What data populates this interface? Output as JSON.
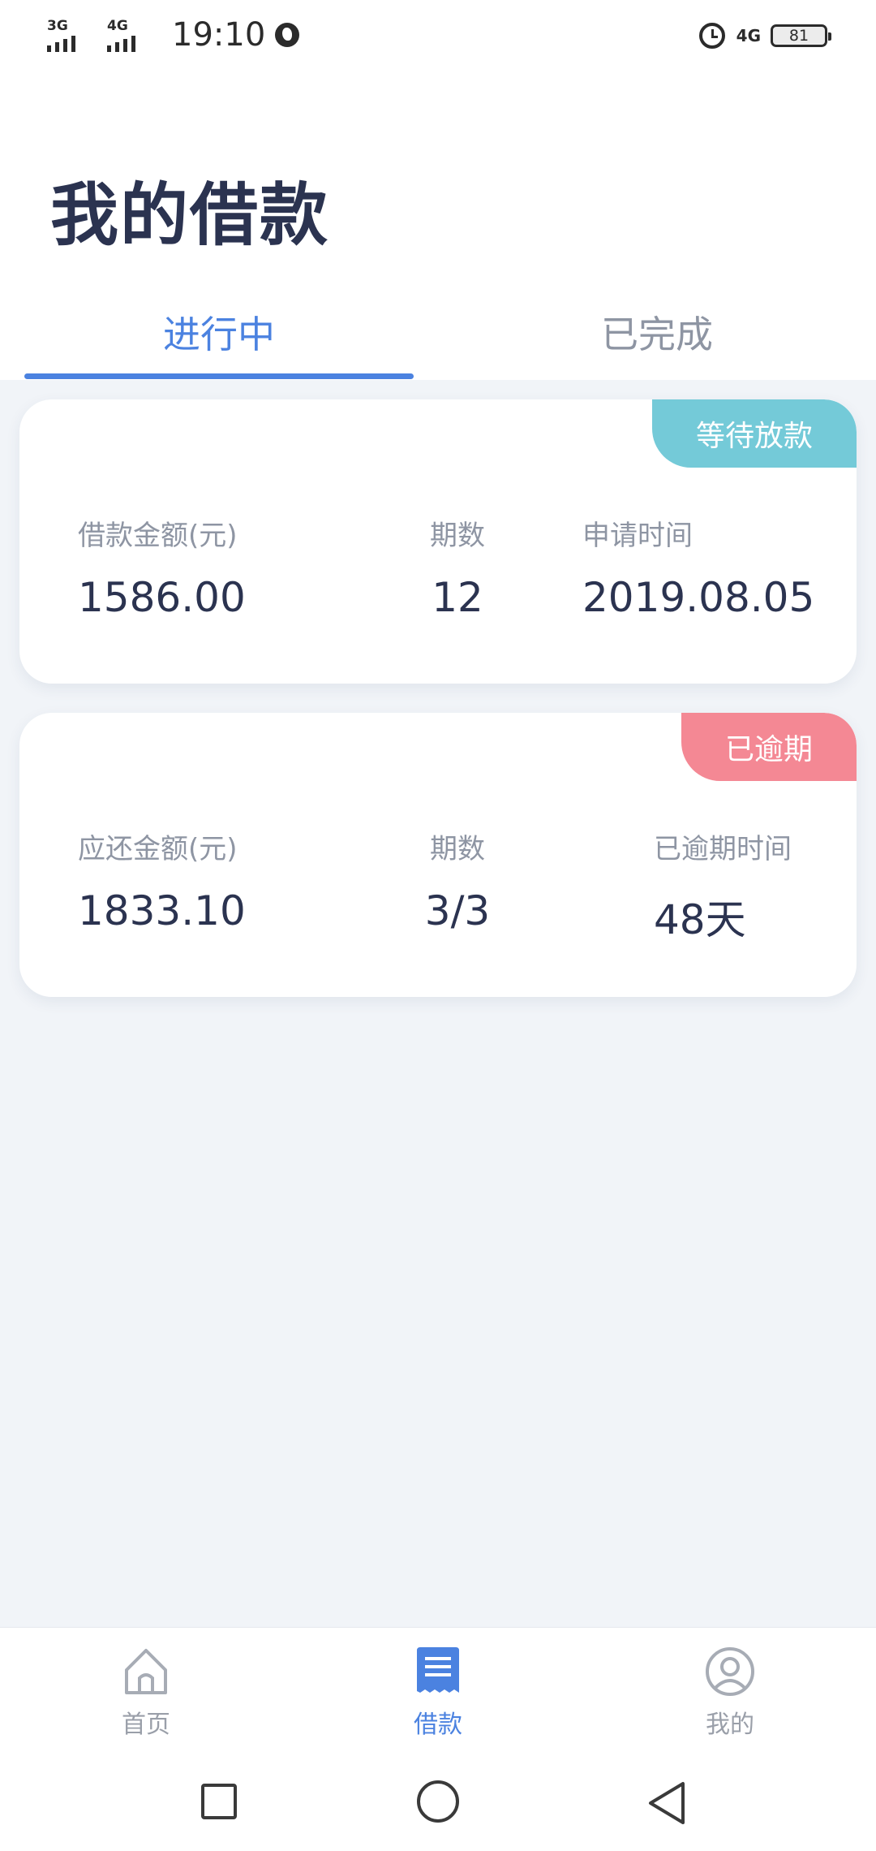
{
  "status_bar": {
    "signal_1": "3G",
    "signal_2": "4G",
    "time": "19:10",
    "network": "4G",
    "battery": "81",
    "icons": [
      "signal-icon",
      "globe-icon",
      "alarm-icon",
      "battery-icon"
    ]
  },
  "header": {
    "title": "我的借款",
    "tabs": [
      {
        "label": "进行中",
        "active": true
      },
      {
        "label": "已完成",
        "active": false
      }
    ]
  },
  "loans": [
    {
      "status": "等待放款",
      "status_color": "#74cad8",
      "fields": [
        {
          "label": "借款金额(元)",
          "value": "1586.00"
        },
        {
          "label": "期数",
          "value": "12"
        },
        {
          "label": "申请时间",
          "value": "2019.08.05"
        }
      ]
    },
    {
      "status": "已逾期",
      "status_color": "#f48894",
      "fields": [
        {
          "label": "应还金额(元)",
          "value": "1833.10"
        },
        {
          "label": "期数",
          "value": "3/3"
        },
        {
          "label": "已逾期时间",
          "value": "48天"
        }
      ]
    }
  ],
  "bottom_nav": {
    "items": [
      {
        "label": "首页",
        "icon": "home-icon",
        "active": false
      },
      {
        "label": "借款",
        "icon": "loan-receipt-icon",
        "active": true
      },
      {
        "label": "我的",
        "icon": "user-icon",
        "active": false
      }
    ]
  },
  "colors": {
    "accent": "#4b82e0",
    "background": "#f1f4f8",
    "text_primary": "#2b3350",
    "text_secondary": "#8e95a3"
  }
}
